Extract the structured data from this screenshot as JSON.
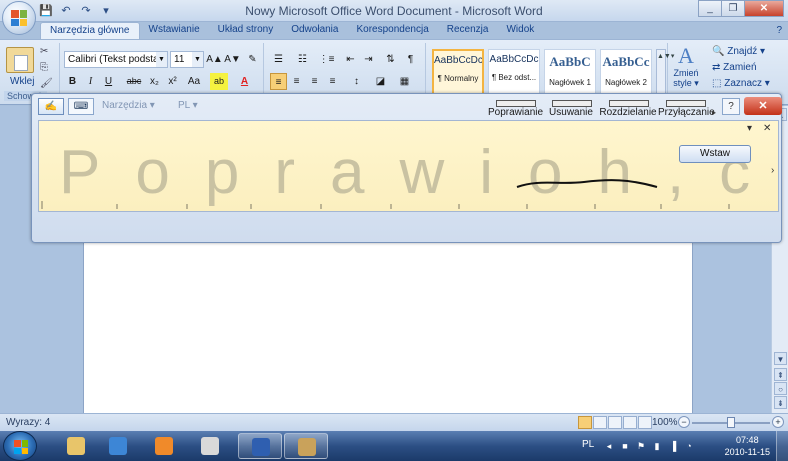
{
  "window": {
    "title": "Nowy Microsoft Office Word Document - Microsoft Word",
    "controls": [
      "_",
      "❐",
      "✕"
    ]
  },
  "quick_access": [
    "💾",
    "↶",
    "↷",
    "▾"
  ],
  "ribbon": {
    "tabs": [
      "Narzędzia główne",
      "Wstawianie",
      "Układ strony",
      "Odwołania",
      "Korespondencja",
      "Recenzja",
      "Widok"
    ],
    "active_tab": "Narzędzia główne",
    "help_icon": "?",
    "clipboard": {
      "paste_label": "Wklej",
      "group_caption": "Schowek",
      "small_icons": [
        "✂",
        "⎘",
        "🖌"
      ]
    },
    "font": {
      "name": "Calibri (Tekst podstawowy)",
      "size": "11",
      "buttons_row1": [
        "A▲",
        "A▼",
        "✎"
      ],
      "buttons_row2": [
        "B",
        "I",
        "U",
        "abc",
        "x₂",
        "x²",
        "Aa"
      ],
      "highlight": "ab",
      "font_color": "A",
      "font_color_hex": "#e02020",
      "highlight_hex": "#f5f240"
    },
    "paragraph": {
      "buttons_row1": [
        "☰",
        "☷",
        "⋮≡",
        "⇤",
        "⇥",
        "⇅",
        "¶"
      ],
      "buttons_row2": [
        "≡",
        "≡",
        "≡",
        "≡",
        "↕",
        "◪",
        "▦"
      ]
    },
    "styles": [
      {
        "sample": "AaBbCcDc",
        "name": "¶ Normalny",
        "big": false,
        "selected": true
      },
      {
        "sample": "AaBbCcDc",
        "name": "¶ Bez odst...",
        "big": false,
        "selected": false
      },
      {
        "sample": "AaBbC",
        "name": "Nagłówek 1",
        "big": true,
        "selected": false
      },
      {
        "sample": "AaBbCc",
        "name": "Nagłówek 2",
        "big": true,
        "selected": false
      }
    ],
    "change_styles": {
      "line1": "Zmień",
      "line2": "style ▾"
    },
    "editing": [
      "Znajdź ▾",
      "Zamień",
      "Zaznacz ▾"
    ]
  },
  "tip": {
    "menu_tools": "Narzędzia ▾",
    "menu_lang": "PL ▾",
    "actions": [
      "Poprawianie",
      "Usuwanie",
      "Rozdzielanie",
      "Przyłączanie"
    ],
    "help": "?",
    "close": "✕",
    "writing_text": "Poprawioh,c",
    "dropdown": "▾",
    "close_small": "✕",
    "scroll_right": "›",
    "insert_label": "Wstaw",
    "more_arrow": "▸"
  },
  "status": {
    "words": "Wyrazy: 4",
    "zoom": "100%",
    "zoom_level": 0.5,
    "zoom_minus": "−",
    "zoom_plus": "+"
  },
  "scrollbar": {
    "up": "▲",
    "down": "▼",
    "prev": "⇞",
    "select": "○",
    "next": "⇟"
  },
  "taskbar": {
    "items": [
      {
        "name": "explorer",
        "color": "#e8c56a",
        "open": false
      },
      {
        "name": "internet-explorer",
        "color": "#3d86d6",
        "open": false
      },
      {
        "name": "media-player",
        "color": "#f08a2a",
        "open": false
      },
      {
        "name": "handwriting",
        "color": "#d9d9d9",
        "open": false
      },
      {
        "name": "word",
        "color": "#2f5fb0",
        "open": true
      },
      {
        "name": "paint",
        "color": "#c9a25b",
        "open": true
      }
    ],
    "tray_lang": "PL",
    "tray_icons": [
      "◂",
      "■",
      "⚑",
      "▮",
      "▐",
      "◔"
    ],
    "time": "07:48",
    "date": "2010-11-15"
  }
}
